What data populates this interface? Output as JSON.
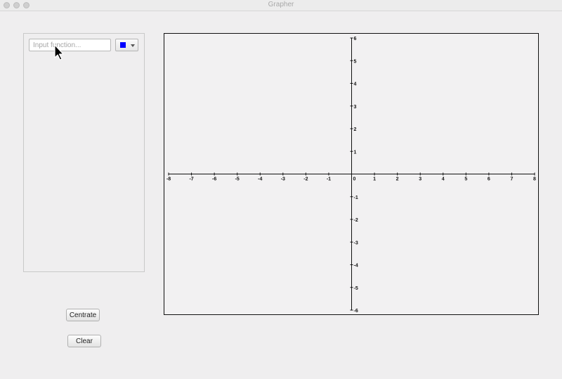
{
  "window": {
    "title": "Grapher"
  },
  "function_panel": {
    "input": {
      "placeholder": "Input function...",
      "value": ""
    },
    "color_picker": {
      "selected_color": "#0000ff"
    }
  },
  "buttons": {
    "centrate_label": "Centrate",
    "clear_label": "Clear"
  },
  "graph": {
    "x_range": [
      -8,
      8
    ],
    "y_range": [
      -6,
      6
    ],
    "x_ticks": [
      "-8",
      "-7",
      "-6",
      "-5",
      "-4",
      "-3",
      "-2",
      "-1",
      "0",
      "1",
      "2",
      "3",
      "4",
      "5",
      "6",
      "7",
      "8"
    ],
    "y_ticks": [
      "6",
      "5",
      "4",
      "3",
      "2",
      "1",
      "-1",
      "-2",
      "-3",
      "-4",
      "-5",
      "-6"
    ]
  },
  "icons": {
    "cursor": "arrow-cursor-icon",
    "dropdown": "chevron-down-icon"
  }
}
